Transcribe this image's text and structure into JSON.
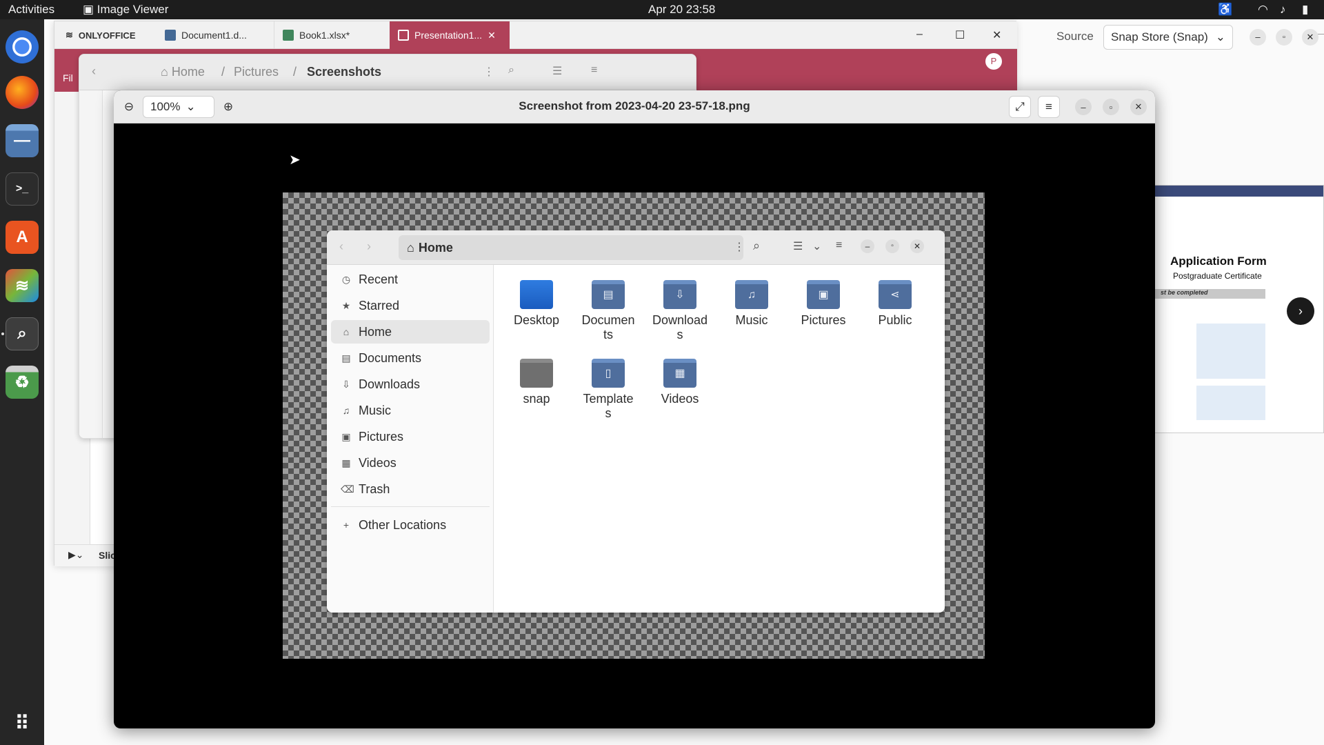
{
  "topbar": {
    "activities": "Activities",
    "app_name": "Image Viewer",
    "clock": "Apr 20  23:58"
  },
  "dock": {
    "items": [
      "chrome-icon",
      "firefox-icon",
      "files-icon",
      "terminal-icon",
      "app-center-icon",
      "onlyoffice-icon",
      "image-viewer-icon",
      "recycle-icon"
    ]
  },
  "onlyoffice": {
    "brand": "ONLYOFFICE",
    "tabs": [
      {
        "label": "Document1.d...",
        "color": "#446995"
      },
      {
        "label": "Book1.xlsx*",
        "color": "#40865c"
      },
      {
        "label": "Presentation1...",
        "color": "#b04159"
      }
    ],
    "avatar": "P",
    "bottom_label": "Slic",
    "red_label": "Fil",
    "accent": "#b04159"
  },
  "bg_files": {
    "crumbs": [
      "Home",
      "Pictures",
      "Screenshots"
    ]
  },
  "snap": {
    "source_label": "Source",
    "source_value": "Snap Store (Snap)"
  },
  "form_preview": {
    "title": "Application Form",
    "subtitle": "Postgraduate Certificate",
    "bar_text": "st be completed"
  },
  "viewer": {
    "zoom": "100%",
    "title": "Screenshot from 2023-04-20 23-57-18.png"
  },
  "fm": {
    "path": "Home",
    "sidebar": [
      {
        "label": "Recent",
        "icon": "clock-icon",
        "glyph": "◷"
      },
      {
        "label": "Starred",
        "icon": "star-icon",
        "glyph": "★"
      },
      {
        "label": "Home",
        "icon": "home-icon",
        "glyph": "⌂"
      },
      {
        "label": "Documents",
        "icon": "document-icon",
        "glyph": "▤"
      },
      {
        "label": "Downloads",
        "icon": "download-icon",
        "glyph": "⇩"
      },
      {
        "label": "Music",
        "icon": "music-icon",
        "glyph": "♫"
      },
      {
        "label": "Pictures",
        "icon": "picture-icon",
        "glyph": "▣"
      },
      {
        "label": "Videos",
        "icon": "video-icon",
        "glyph": "▦"
      },
      {
        "label": "Trash",
        "icon": "trash-icon",
        "glyph": "⌫"
      }
    ],
    "other_locations": "Other Locations",
    "folders": [
      {
        "label": "Desktop",
        "glyph": ""
      },
      {
        "label": "Documen\nts",
        "glyph": "▤"
      },
      {
        "label": "Download\ns",
        "glyph": "⇩"
      },
      {
        "label": "Music",
        "glyph": "♫"
      },
      {
        "label": "Pictures",
        "glyph": "▣"
      },
      {
        "label": "Public",
        "glyph": "⋖"
      },
      {
        "label": "snap",
        "glyph": ""
      },
      {
        "label": "Template\ns",
        "glyph": "▯"
      },
      {
        "label": "Videos",
        "glyph": "▦"
      }
    ]
  }
}
